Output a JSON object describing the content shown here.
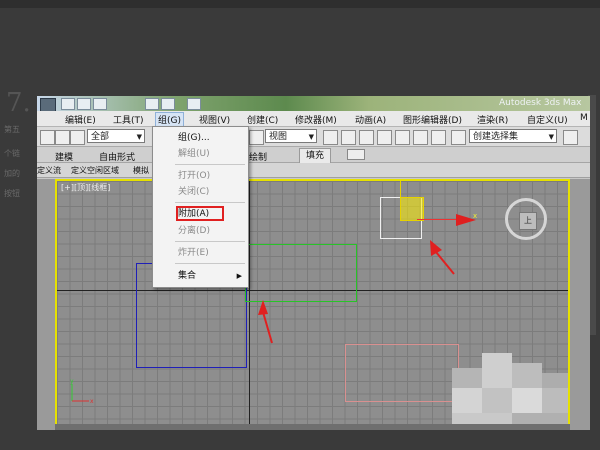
{
  "app": {
    "title": "Autodesk 3ds Max"
  },
  "background": {
    "heading": "7.",
    "lines": [
      "第五",
      "个链",
      "加的",
      "按钮"
    ]
  },
  "menubar": {
    "items": [
      {
        "label": "编辑(E)"
      },
      {
        "label": "工具(T)"
      },
      {
        "label": "组(G)"
      },
      {
        "label": "视图(V)"
      },
      {
        "label": "创建(C)"
      },
      {
        "label": "修改器(M)"
      },
      {
        "label": "动画(A)"
      },
      {
        "label": "图形编辑器(D)"
      },
      {
        "label": "渲染(R)"
      },
      {
        "label": "自定义(U)"
      },
      {
        "label": "M"
      }
    ]
  },
  "toolbar": {
    "filter_select": "全部",
    "view_select": "视图",
    "selection_set": "创建选择集"
  },
  "ribbon": {
    "tabs": [
      "建模",
      "自由形式",
      "绘制",
      "填充"
    ]
  },
  "subbar": {
    "items": [
      "定义流",
      "定义空闲区域",
      "模拟"
    ]
  },
  "viewport": {
    "label": "[+][顶][线框]",
    "gizmo_axis": "x",
    "viewcube_face": "上"
  },
  "group_menu": {
    "items": [
      {
        "label": "组(G)...",
        "enabled": true
      },
      {
        "label": "解组(U)",
        "enabled": false
      },
      {
        "label": "打开(O)",
        "enabled": false
      },
      {
        "label": "关闭(C)",
        "enabled": false
      },
      {
        "label": "附加(A)",
        "enabled": true,
        "highlighted": true
      },
      {
        "label": "分离(D)",
        "enabled": false
      },
      {
        "label": "炸开(E)",
        "enabled": false
      },
      {
        "label": "集合",
        "enabled": true,
        "submenu": true
      }
    ]
  },
  "colors": {
    "viewport_border": "#e6e100",
    "highlight": "#e02020",
    "annotation_arrow": "#e02020"
  }
}
